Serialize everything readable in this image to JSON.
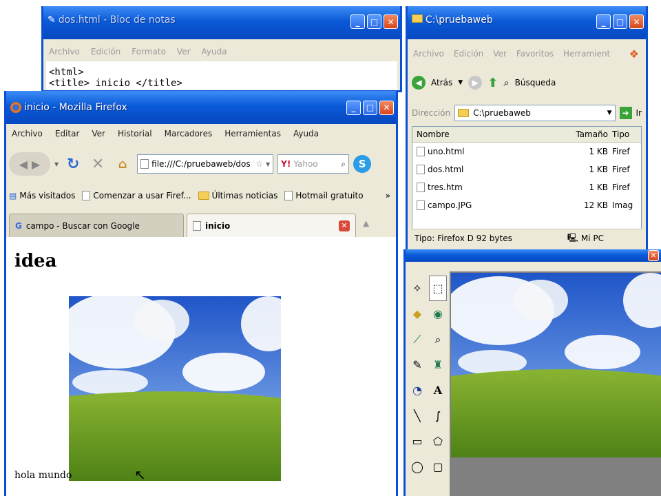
{
  "notepad": {
    "title": "dos.html - Bloc de notas",
    "menu": [
      "Archivo",
      "Edición",
      "Formato",
      "Ver",
      "Ayuda"
    ],
    "lines": [
      "<html>",
      "<title> inicio </title>"
    ]
  },
  "explorer": {
    "title": "C:\\pruebaweb",
    "menu": [
      "Archivo",
      "Edición",
      "Ver",
      "Favoritos",
      "Herramient"
    ],
    "back_label": "Atrás",
    "search_label": "Búsqueda",
    "address_label": "Dirección",
    "address_value": "C:\\pruebaweb",
    "go_label": "Ir",
    "columns": {
      "name": "Nombre",
      "size": "Tamaño",
      "type": "Tipo"
    },
    "files": [
      {
        "name": "uno.html",
        "size": "1 KB",
        "type": "Firef"
      },
      {
        "name": "dos.html",
        "size": "1 KB",
        "type": "Firef"
      },
      {
        "name": "tres.htm",
        "size": "1 KB",
        "type": "Firef"
      },
      {
        "name": "campo.JPG",
        "size": "12 KB",
        "type": "Imag"
      }
    ],
    "status_type": "Tipo: Firefox D 92 bytes",
    "status_location": "Mi PC"
  },
  "firefox": {
    "title": "inicio - Mozilla Firefox",
    "menu": [
      "Archivo",
      "Editar",
      "Ver",
      "Historial",
      "Marcadores",
      "Herramientas",
      "Ayuda"
    ],
    "url": "file:///C:/pruebaweb/dos",
    "search_placeholder": "Yahoo",
    "bookmarks": [
      "Más visitados",
      "Comenzar a usar Firef...",
      "Últimas noticias",
      "Hotmail gratuito"
    ],
    "tabs": [
      {
        "label": "campo - Buscar con Google",
        "active": false
      },
      {
        "label": "inicio",
        "active": true
      }
    ],
    "page": {
      "heading": "idea",
      "text": "hola mundo"
    }
  },
  "colors": {
    "xp_blue": "#0a4fd6",
    "window_face": "#ece9d8",
    "sky": "#2f6ad8",
    "grass": "#6c9c1e"
  }
}
